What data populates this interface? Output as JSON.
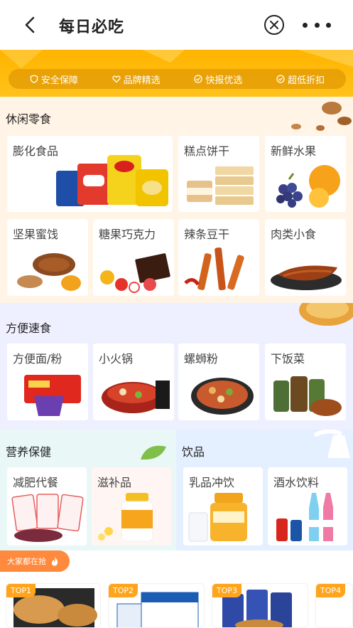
{
  "nav": {
    "title": "每日必吃",
    "back_icon": "chevron-left-icon",
    "close_icon": "close-circle-icon",
    "more_icon": "more-dots-icon"
  },
  "banner": {
    "badges": [
      "安全保障",
      "品牌精选",
      "快报优选",
      "超低折扣"
    ]
  },
  "snacks": {
    "heading": "休闲零食",
    "items": [
      "膨化食品",
      "糕点饼干",
      "新鲜水果",
      "坚果蜜饯",
      "糖果巧克力",
      "辣条豆干",
      "肉类小食"
    ]
  },
  "fastfood": {
    "heading": "方便速食",
    "items": [
      "方便面/粉",
      "小火锅",
      "螺蛳粉",
      "下饭菜"
    ]
  },
  "health": {
    "heading": "营养保健",
    "items": [
      "减肥代餐",
      "滋补品"
    ]
  },
  "drinks": {
    "heading": "饮品",
    "items": [
      "乳品冲饮",
      "酒水饮料"
    ]
  },
  "hot": {
    "label": "大家都在抢"
  },
  "tops": [
    "TOP1",
    "TOP2",
    "TOP3",
    "TOP4"
  ],
  "colors": {
    "accent": "#ffb400",
    "tag": "#ffa41b",
    "hot": "#ff8a3d"
  }
}
